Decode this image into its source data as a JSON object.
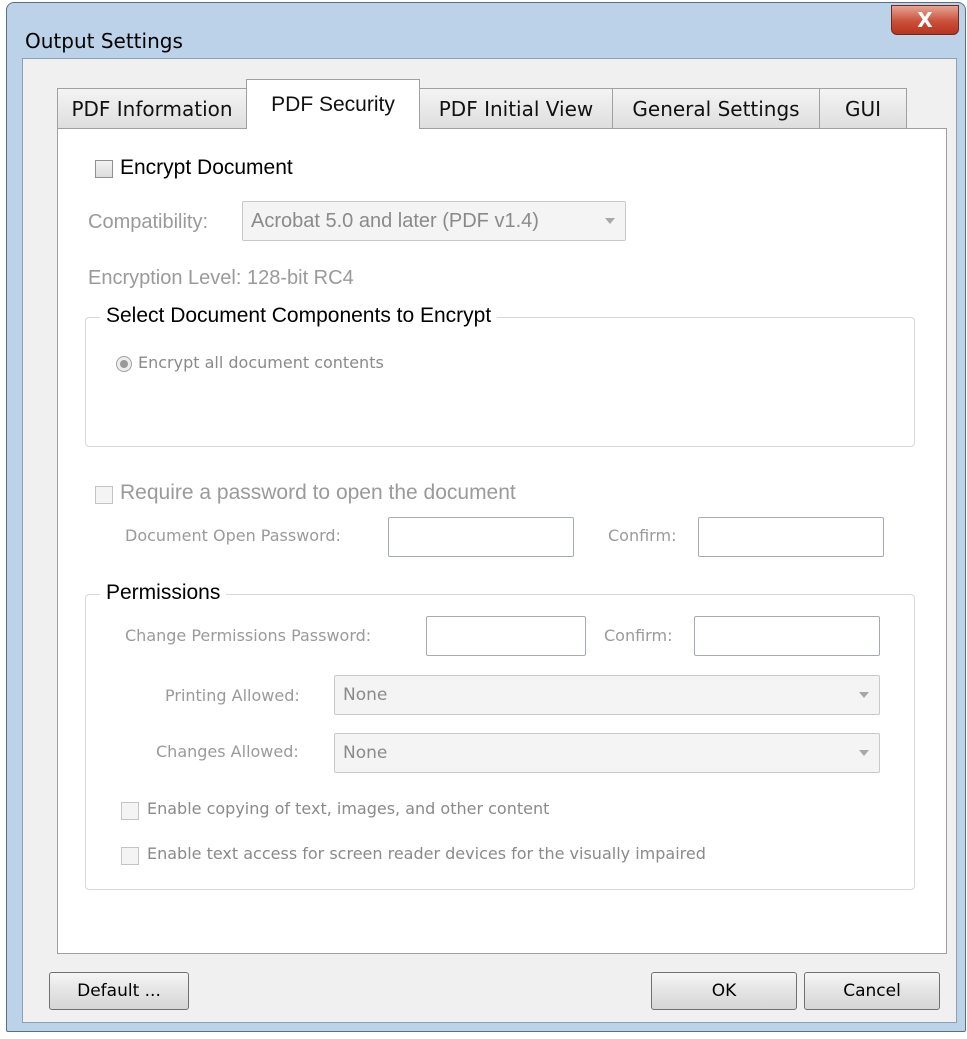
{
  "window": {
    "title": "Output Settings",
    "close_glyph": "X"
  },
  "tabs": [
    {
      "label": "PDF Information"
    },
    {
      "label": "PDF Security"
    },
    {
      "label": "PDF Initial View"
    },
    {
      "label": "General Settings"
    },
    {
      "label": "GUI"
    }
  ],
  "active_tab": "PDF Security",
  "security": {
    "encrypt_label": "Encrypt Document",
    "encrypt_checked": false,
    "compatibility_label": "Compatibility:",
    "compatibility_value": "Acrobat 5.0 and later (PDF v1.4)",
    "encryption_level": "Encryption Level: 128-bit RC4",
    "components_group": "Select Document Components to Encrypt",
    "encrypt_all_label": "Encrypt all document contents",
    "require_password_label": "Require a password to open the document",
    "open_password_label": "Document Open Password:",
    "open_password_value": "",
    "confirm_label": "Confirm:",
    "confirm_value": ""
  },
  "permissions": {
    "group": "Permissions",
    "change_password_label": "Change Permissions Password:",
    "change_password_value": "",
    "confirm_label": "Confirm:",
    "confirm_value": "",
    "printing_label": "Printing Allowed:",
    "printing_value": "None",
    "changes_label": "Changes Allowed:",
    "changes_value": "None",
    "copy_label": "Enable copying of text, images, and other content",
    "screen_reader_label": "Enable text access for screen reader devices for the visually impaired"
  },
  "buttons": {
    "default": "Default ...",
    "ok": "OK",
    "cancel": "Cancel"
  },
  "colors": {
    "title_bar": "#bcd2e8",
    "close_button": "#c9503a",
    "disabled_text": "#9a9a9a"
  }
}
